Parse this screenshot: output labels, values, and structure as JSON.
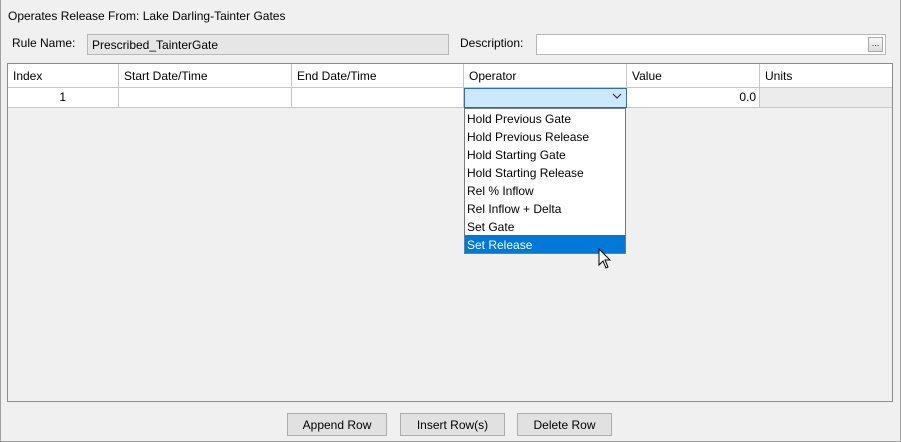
{
  "panel": {
    "header": "Operates Release From: Lake Darling-Tainter Gates",
    "rule_name_label": "Rule Name:",
    "rule_name_value": "Prescribed_TainterGate",
    "description_label": "Description:",
    "description_value": "",
    "description_button": "..."
  },
  "table": {
    "columns": [
      "Index",
      "Start Date/Time",
      "End Date/Time",
      "Operator",
      "Value",
      "Units"
    ],
    "rows": [
      {
        "index": "1",
        "start": "",
        "end": "",
        "operator": "",
        "value": "0.0",
        "units": ""
      }
    ]
  },
  "operator_dropdown": {
    "options": [
      "Hold Previous Gate",
      "Hold Previous Release",
      "Hold Starting Gate",
      "Hold Starting Release",
      "Rel % Inflow",
      "Rel Inflow + Delta",
      "Set Gate",
      "Set Release"
    ],
    "highlighted": "Set Release",
    "icon": "chevron-down-icon"
  },
  "buttons": {
    "append": "Append Row",
    "insert": "Insert Row(s)",
    "delete": "Delete Row"
  },
  "colors": {
    "selection": "#0078d7",
    "combo_background": "#cce8ff",
    "panel_background": "#f0f0f0"
  }
}
